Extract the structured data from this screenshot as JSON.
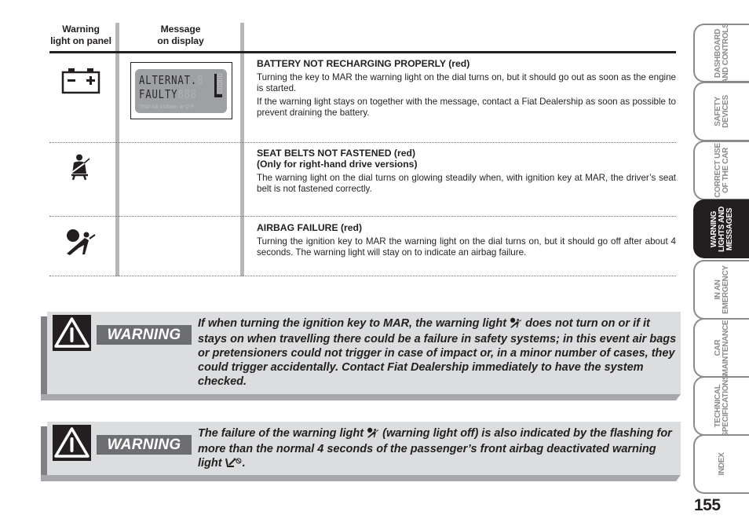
{
  "table": {
    "headers": {
      "warning_light": [
        "Warning",
        "light on panel"
      ],
      "message": [
        "Message",
        "on display"
      ]
    },
    "rows": [
      {
        "icon": "battery-icon",
        "display": {
          "line1": "ALTERNAT.",
          "line2": "FAULTY",
          "footer": "TRIP AB l/100km ⊕°C°F"
        },
        "title": "BATTERY NOT RECHARGING PROPERLY (red)",
        "subtitle": "",
        "paragraphs": [
          "Turning the key to MAR the warning light on the dial turns on, but it should go out as soon as the engine is started.",
          "If the warning light stays on together with the message, contact a Fiat Dealership as soon as possible to prevent draining the battery."
        ]
      },
      {
        "icon": "seat-belt-icon",
        "title": "SEAT BELTS NOT FASTENED (red)",
        "subtitle": "(Only for right-hand drive versions)",
        "paragraphs": [
          "The warning light on the dial turns on glowing steadily when, with ignition key at MAR, the driver’s seat belt is not fastened correctly."
        ]
      },
      {
        "icon": "airbag-icon",
        "title": "AIRBAG FAILURE (red)",
        "subtitle": "",
        "paragraphs": [
          "Turning the ignition key to MAR the warning light on the dial turns on, but it should go off after about 4 seconds. The warning light will stay on to indicate an airbag failure."
        ]
      }
    ]
  },
  "warnings": [
    {
      "label": "WARNING",
      "text_before_icon": "If when turning the ignition key to MAR, the warning light ",
      "text_after_icon": " does not turn on or if it stays on when travelling there could be a failure in safety systems; in this event air bags or pretensioners could not trigger in case of impact or, in a minor number of cases, they could trigger accidentally. Contact Fiat Dealership immediately to have the system checked."
    },
    {
      "label": "WARNING",
      "text_before_icon": "The failure of the warning light ",
      "text_middle": " (warning light off) is also indicated by the flashing for more than the normal 4 seconds of the passenger’s front airbag deactivated warning light ",
      "text_end": "."
    }
  ],
  "side_tabs": [
    {
      "lines": [
        "DASHBOARD",
        "AND CONTROLS"
      ],
      "active": false
    },
    {
      "lines": [
        "SAFETY",
        "DEVICES"
      ],
      "active": false
    },
    {
      "lines": [
        "CORRECT USE",
        "OF THE CAR"
      ],
      "active": false
    },
    {
      "lines": [
        "WARNING",
        "LIGHTS AND",
        "MESSAGES"
      ],
      "active": true
    },
    {
      "lines": [
        "IN AN",
        "EMERGENCY"
      ],
      "active": false
    },
    {
      "lines": [
        "CAR",
        "MAINTENANCE"
      ],
      "active": false
    },
    {
      "lines": [
        "TECHNICAL",
        "SPECIFICATIONS"
      ],
      "active": false
    },
    {
      "lines": [
        "INDEX"
      ],
      "active": false
    }
  ],
  "page_number": "155",
  "colors": {
    "text": "#231f20",
    "column_bar": "#b6b7b9",
    "warning_face": "#dcdddf",
    "warning_label_bg": "#6d6e71",
    "tab_border": "#8a8b8d"
  }
}
